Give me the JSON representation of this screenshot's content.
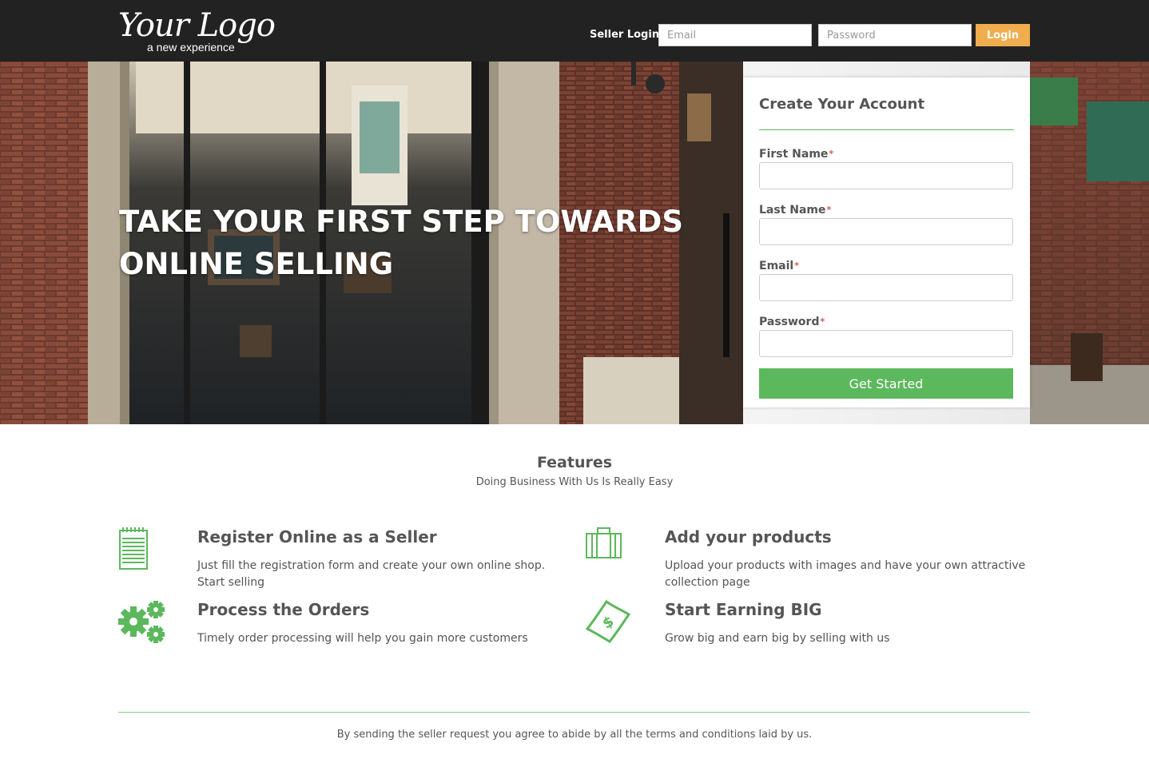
{
  "header": {
    "logo_text": "Your Logo",
    "logo_tagline": "a new experience",
    "seller_login_label": "Seller Login",
    "email_placeholder": "Email",
    "password_placeholder": "Password",
    "login_button": "Login"
  },
  "hero": {
    "headline_line1": "TAKE YOUR FIRST STEP TOWARDS",
    "headline_line2": "ONLINE SELLING"
  },
  "signup_form": {
    "title": "Create Your Account",
    "fields": [
      {
        "label": "First Name",
        "required_mark": "*"
      },
      {
        "label": "Last Name",
        "required_mark": "*"
      },
      {
        "label": "Email",
        "required_mark": "*"
      },
      {
        "label": "Password",
        "required_mark": "*"
      }
    ],
    "submit_label": "Get Started"
  },
  "features": {
    "title": "Features",
    "subtitle": "Doing Business With Us Is Really Easy",
    "items": [
      {
        "icon": "notepad-icon",
        "heading": "Register Online as a Seller",
        "text": "Just fill the registration form and create your own online shop. Start selling"
      },
      {
        "icon": "suitcase-icon",
        "heading": "Add your products",
        "text": "Upload your products with images and have your own attractive collection page"
      },
      {
        "icon": "gears-icon",
        "heading": "Process the Orders",
        "text": "Timely order processing will help you gain more customers"
      },
      {
        "icon": "money-icon",
        "heading": "Start Earning BIG",
        "text": "Grow big and earn big by selling with us"
      }
    ]
  },
  "footer": {
    "text": "By sending the seller request you agree to abide by all the terms and conditions laid by us."
  },
  "colors": {
    "topbar": "#222222",
    "accent_green": "#5cb85c",
    "login_orange": "#f0ad4e"
  }
}
